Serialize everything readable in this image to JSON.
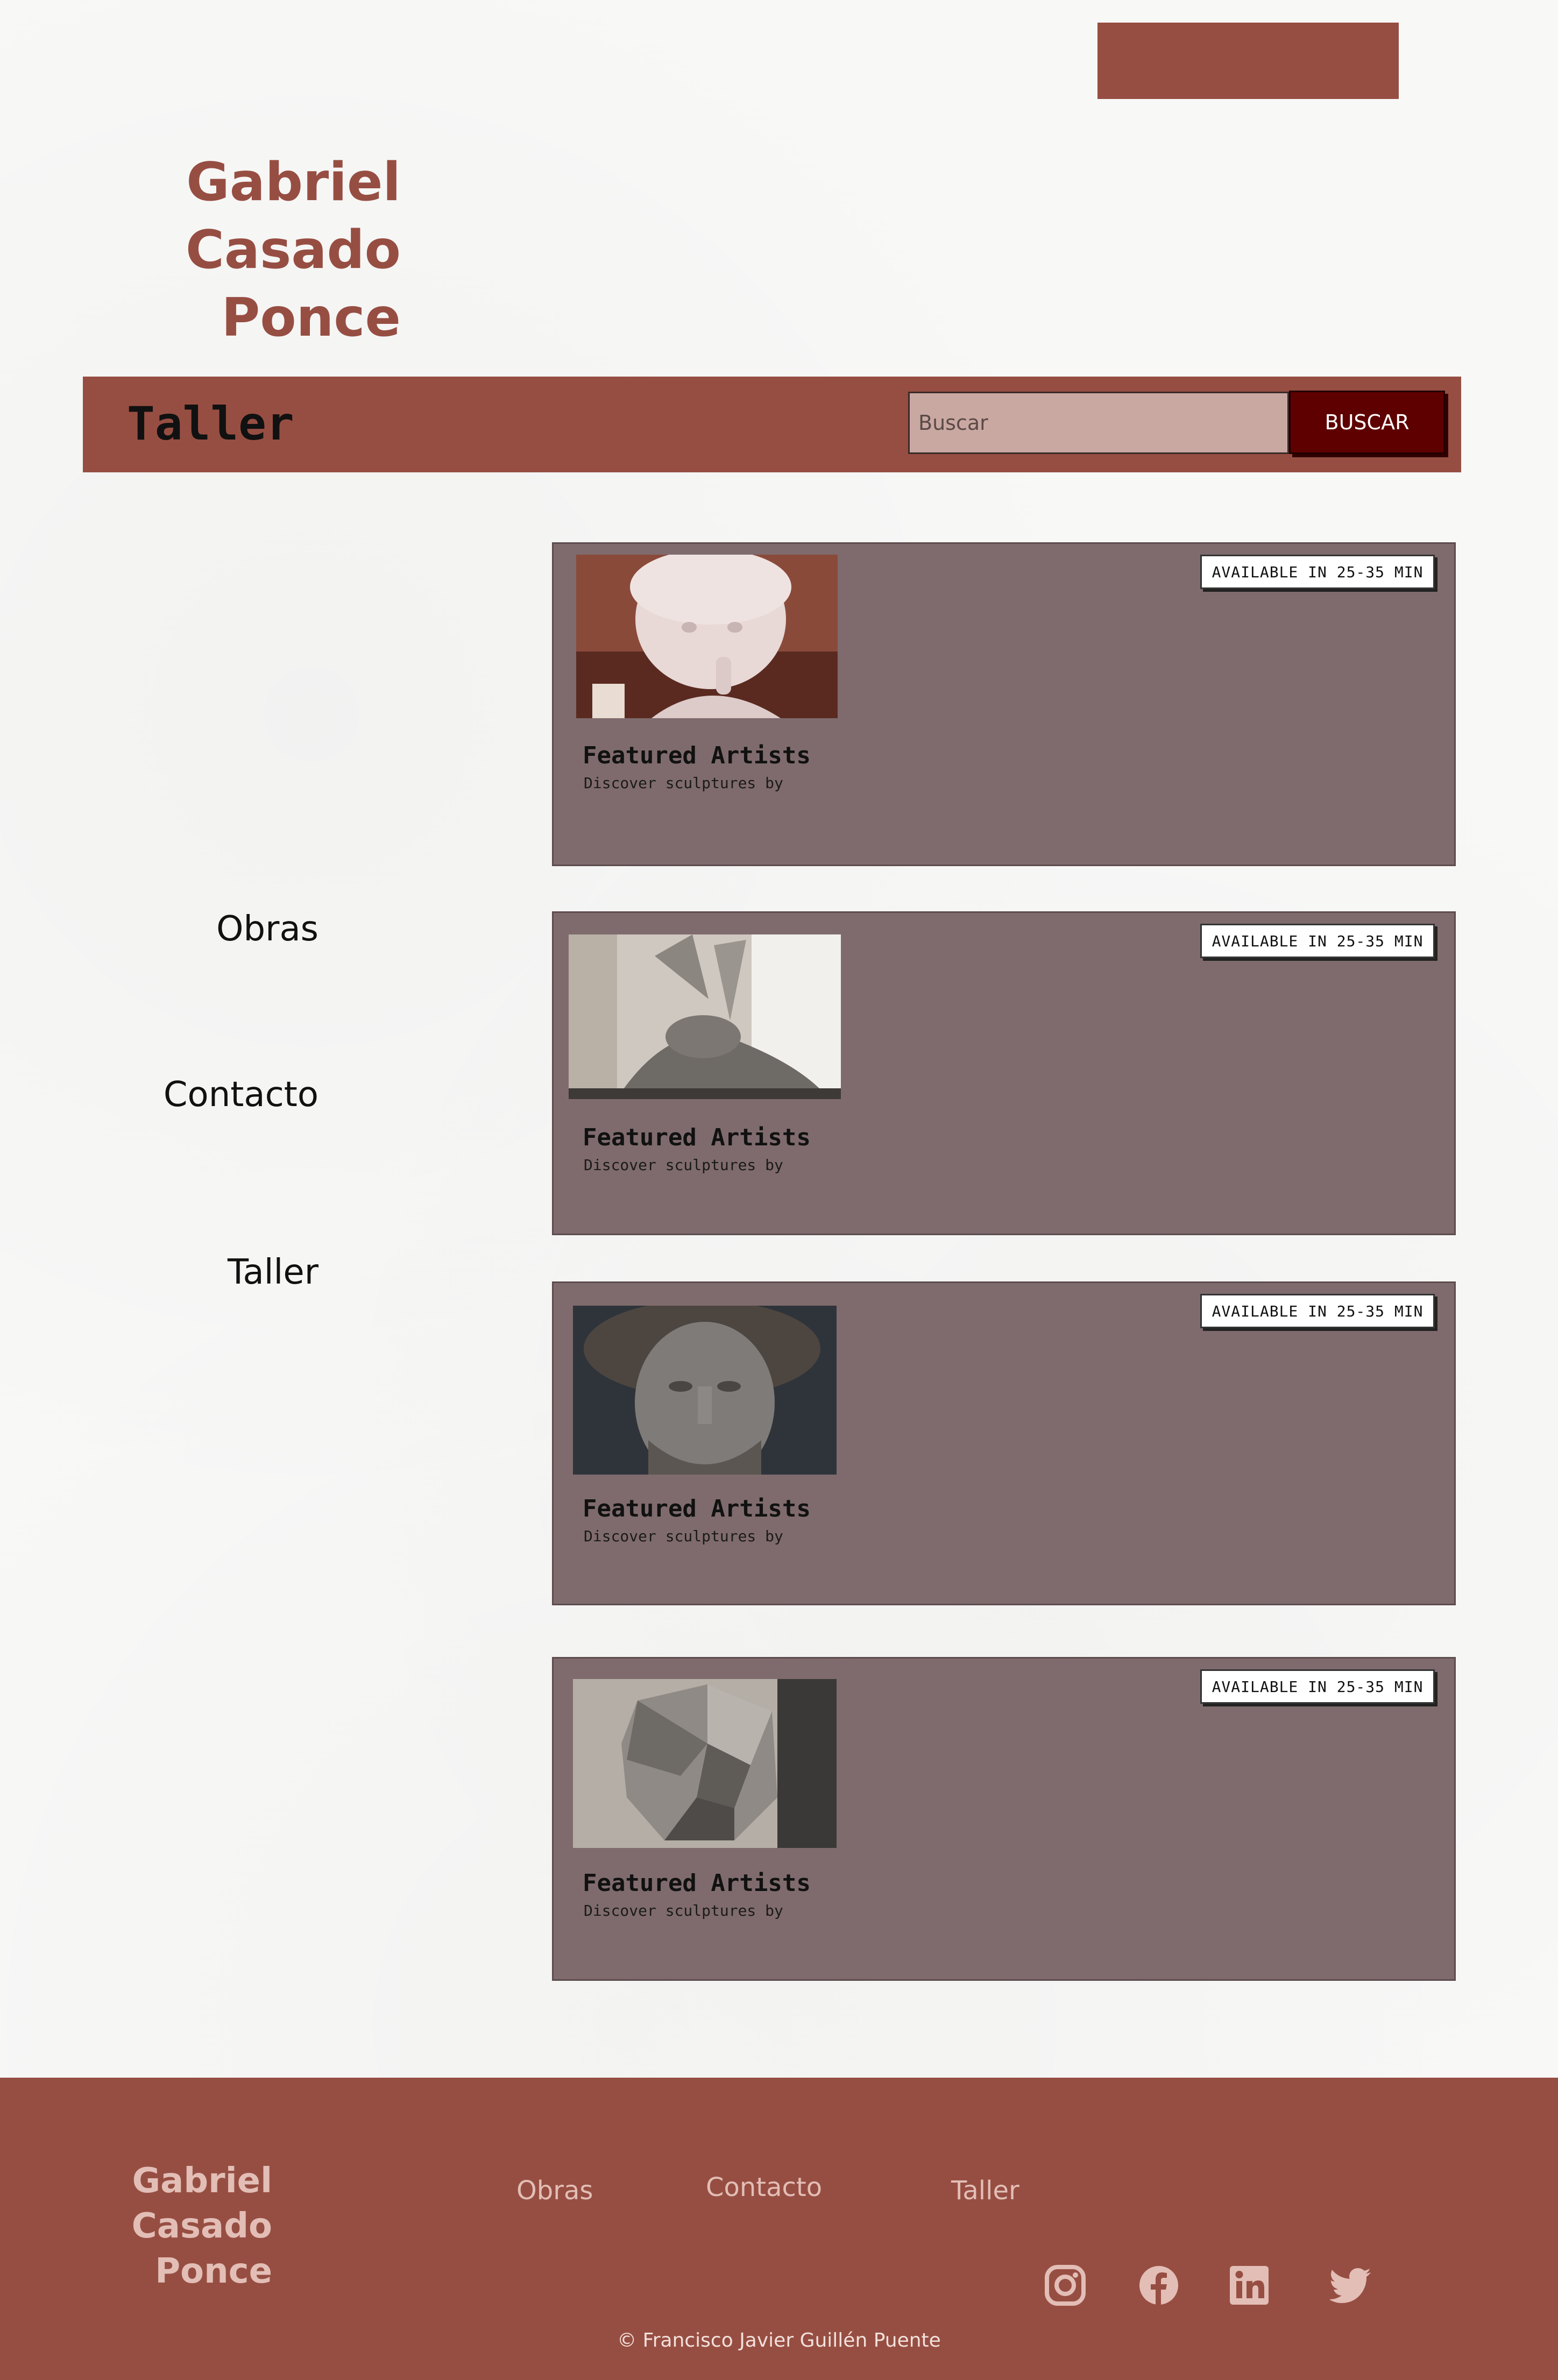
{
  "brand": {
    "line1": "Gabriel",
    "line2": "Casado",
    "line3": "Ponce"
  },
  "banner": {
    "title": "Taller",
    "search_placeholder": "Buscar",
    "search_button": "BUSCAR"
  },
  "side_nav": {
    "items": [
      {
        "label": "Obras"
      },
      {
        "label": "Contacto"
      },
      {
        "label": "Taller"
      }
    ]
  },
  "cards": [
    {
      "badge": "AVAILABLE IN 25-35 MIN",
      "title": "Featured Artists",
      "subtitle": "Discover sculptures by"
    },
    {
      "badge": "AVAILABLE IN 25-35 MIN",
      "title": "Featured Artists",
      "subtitle": "Discover sculptures by"
    },
    {
      "badge": "AVAILABLE IN 25-35 MIN",
      "title": "Featured Artists",
      "subtitle": "Discover sculptures by"
    },
    {
      "badge": "AVAILABLE IN 25-35 MIN",
      "title": "Featured Artists",
      "subtitle": "Discover sculptures by"
    }
  ],
  "footer": {
    "brand": {
      "line1": "Gabriel",
      "line2": "Casado",
      "line3": "Ponce"
    },
    "links": [
      {
        "label": "Obras"
      },
      {
        "label": "Contacto"
      },
      {
        "label": "Taller"
      }
    ],
    "social_icons": [
      "instagram-icon",
      "facebook-icon",
      "linkedin-icon",
      "twitter-icon"
    ],
    "copyright": "© Francisco Javier Guillén Puente"
  },
  "colors": {
    "accent": "#974e42",
    "button_dark": "#5e0000",
    "card_bg": "#7f6b6d",
    "footer_text": "#e2beb6"
  }
}
